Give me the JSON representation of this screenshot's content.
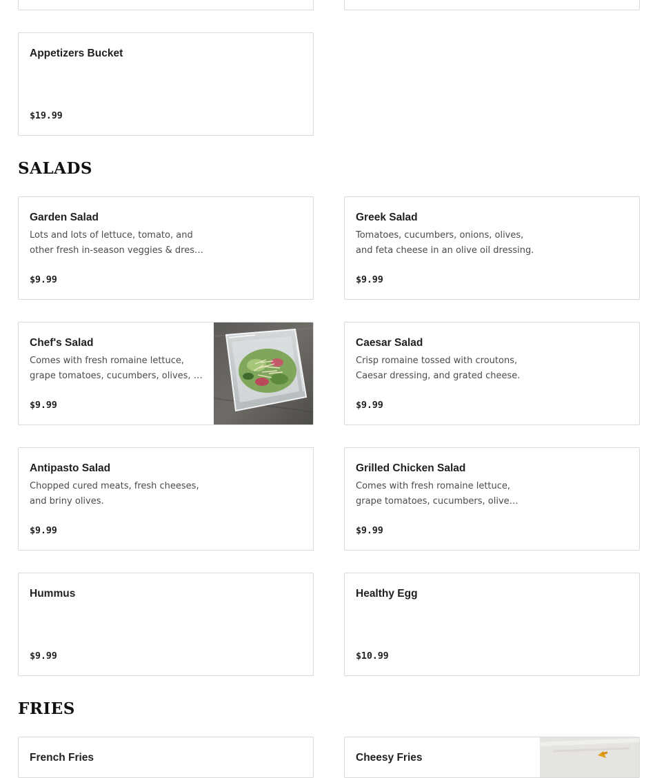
{
  "sections": {
    "salads": {
      "title": "SALADS"
    },
    "fries": {
      "title": "FRIES"
    }
  },
  "items": {
    "appetizers_bucket": {
      "name": "Appetizers Bucket",
      "price": "$19.99"
    },
    "garden_salad": {
      "name": "Garden Salad",
      "desc_lines": [
        "Lots and lots of lettuce, tomato, and",
        "other fresh in-season veggies & dressing."
      ],
      "price": "$9.99"
    },
    "greek_salad": {
      "name": "Greek Salad",
      "desc_lines": [
        "Tomatoes, cucumbers, onions, olives,",
        "and feta cheese in an olive oil dressing."
      ],
      "price": "$9.99"
    },
    "chefs_salad": {
      "name": "Chef's Salad",
      "desc_lines": [
        "Comes with fresh romaine lettuce,",
        "grape tomatoes, cucumbers, olives, and more."
      ],
      "price": "$9.99"
    },
    "caesar_salad": {
      "name": "Caesar Salad",
      "desc_lines": [
        "Crisp romaine tossed with croutons,",
        "Caesar dressing, and grated cheese."
      ],
      "price": "$9.99"
    },
    "antipasto_salad": {
      "name": "Antipasto Salad",
      "desc_lines": [
        "Chopped cured meats, fresh cheeses,",
        "and briny olives."
      ],
      "price": "$9.99"
    },
    "grilled_chicken_salad": {
      "name": "Grilled Chicken Salad",
      "desc_lines": [
        "Comes with fresh romaine lettuce,",
        "grape tomatoes, cucumbers, olives, and more."
      ],
      "price": "$9.99"
    },
    "hummus": {
      "name": "Hummus",
      "price": "$9.99"
    },
    "healthy_egg": {
      "name": "Healthy Egg",
      "price": "$10.99"
    },
    "french_fries": {
      "name": "French Fries"
    },
    "cheesy_fries": {
      "name": "Cheesy Fries"
    }
  },
  "colors": {
    "card_border": "#d9d9d9",
    "text_primary": "#1f1f1f",
    "text_secondary": "#4a4a4a"
  }
}
